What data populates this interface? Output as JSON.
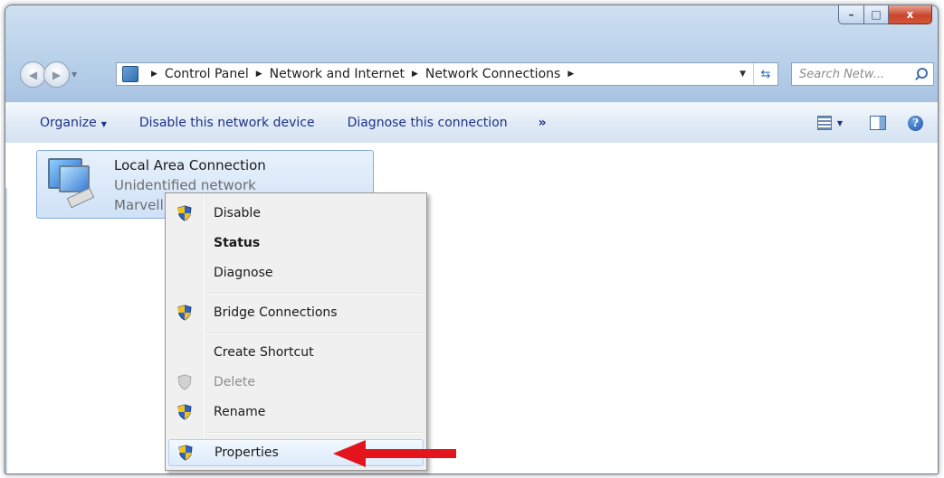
{
  "window": {
    "buttons": {
      "minimize": "–",
      "maximize": "□",
      "close": "x"
    }
  },
  "address_bar": {
    "crumbs": [
      "Control Panel",
      "Network and Internet",
      "Network Connections"
    ],
    "search_placeholder": "Search Netw..."
  },
  "toolbar": {
    "organize": "Organize",
    "disable": "Disable this network device",
    "diagnose": "Diagnose this connection",
    "more": "»"
  },
  "connection": {
    "name": "Local Area Connection",
    "status": "Unidentified network",
    "adapter": "Marvell"
  },
  "context_menu": {
    "items": [
      {
        "label": "Disable",
        "shield": true
      },
      {
        "label": "Status",
        "bold": true
      },
      {
        "label": "Diagnose"
      },
      {
        "label": "Bridge Connections",
        "shield": true
      },
      {
        "label": "Create Shortcut"
      },
      {
        "label": "Delete",
        "shield": true,
        "disabled": true
      },
      {
        "label": "Rename",
        "shield": true
      },
      {
        "label": "Properties",
        "shield": true,
        "highlighted": true
      }
    ]
  },
  "colors": {
    "annotation_arrow": "#e3141b",
    "toolbar_text": "#1e3287"
  }
}
